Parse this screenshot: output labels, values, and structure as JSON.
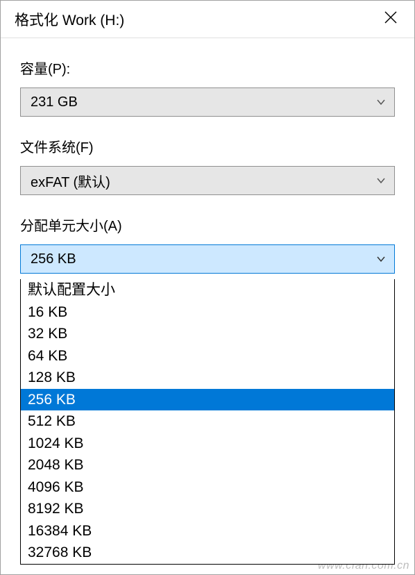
{
  "title": "格式化 Work (H:)",
  "capacity": {
    "label": "容量(P):",
    "value": "231 GB"
  },
  "filesystem": {
    "label": "文件系统(F)",
    "value": "exFAT (默认)"
  },
  "allocation": {
    "label": "分配单元大小(A)",
    "value": "256 KB",
    "options": [
      "默认配置大小",
      "16 KB",
      "32 KB",
      "64 KB",
      "128 KB",
      "256 KB",
      "512 KB",
      "1024 KB",
      "2048 KB",
      "4096 KB",
      "8192 KB",
      "16384 KB",
      "32768 KB"
    ],
    "selected_index": 5
  },
  "watermark": "www.cfan.com.cn"
}
